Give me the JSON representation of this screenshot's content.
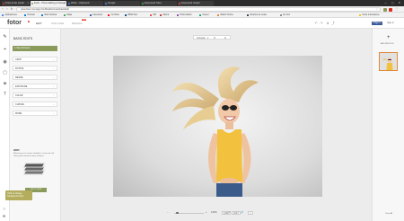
{
  "browser": {
    "tabs": [
      {
        "label": "8 test invite Gmail",
        "color": "#d93025"
      },
      {
        "label": "Fotor - Photo Editing & Design",
        "color": "#8a9a5b",
        "active": true
      },
      {
        "label": "Writer - Clipboard",
        "color": "#3b82f6"
      },
      {
        "label": "Google",
        "color": "#4285f4"
      },
      {
        "label": "Expressed Sites",
        "color": "#34a853"
      },
      {
        "label": "Expressed Insight",
        "color": "#ea4335"
      }
    ],
    "window_controls": "— ▢ ✕",
    "url": "www.fotor.com/app.html#/editor/main/basicEdit",
    "bookmarks": [
      {
        "label": "Aplicaciones",
        "color": "#4285f4"
      },
      {
        "label": "Hotmail",
        "color": "#0078d4"
      },
      {
        "label": "Web Outlook",
        "color": "#0078d4"
      },
      {
        "label": "Maps",
        "color": "#34a853"
      },
      {
        "label": "Facebook",
        "color": "#3b5998"
      },
      {
        "label": "YouTube",
        "color": "#ff0000"
      },
      {
        "label": "BBVA Net",
        "color": "#004481"
      },
      {
        "label": "WK",
        "color": "#e74c3c"
      },
      {
        "label": "Marca",
        "color": "#c0392b"
      },
      {
        "label": "Photo Editor",
        "color": "#8e44ad"
      },
      {
        "label": "Career",
        "color": "#16a085"
      },
      {
        "label": "Watch Online",
        "color": "#e67e22"
      },
      {
        "label": "Diseños de redes",
        "color": "#2c3e50"
      },
      {
        "label": "En Voz",
        "color": "#7f8c8d"
      },
      {
        "label": "Otros marcadores",
        "color": "#f1c40f"
      }
    ]
  },
  "app": {
    "logo": "fotor",
    "logo_badge": "®",
    "nav": [
      {
        "label": "EDIT",
        "active": true
      },
      {
        "label": "COLLAGE",
        "active": false
      },
      {
        "label": "DESIGN",
        "active": false
      }
    ],
    "new_badge": "NEW",
    "signin": "f Sign in",
    "signin2": "Sign in"
  },
  "left_rail": {
    "icons": [
      "wand-icon",
      "crop-icon",
      "eye-icon",
      "frame-icon",
      "sticker-icon",
      "text-icon"
    ]
  },
  "panel": {
    "title": "BASIC EDITS",
    "one_click": "1-Tap Enhance",
    "accordions": [
      "CROP",
      "ROTATE",
      "RESIZE",
      "EXPOSURE",
      "COLOR",
      "CURVES",
      "MORE"
    ],
    "hdr": {
      "title": "HDR",
      "desc": "Allowing you to capture highlights, enhanced and shifting with details of deep shadows.",
      "button": "TRY IT NOW"
    },
    "tooltip": "Click to change background color"
  },
  "canvas": {
    "toolbar": {
      "compare": "Compare",
      "compare_icon": "▾"
    },
    "zoom": {
      "minus": "−",
      "plus": "+",
      "percent": "100%",
      "size_w": "1200",
      "size_x": "x",
      "size_h": "1027",
      "fit": "⛶"
    }
  },
  "right_panel": {
    "add_label": "ADD PHOTOS",
    "clear_all": "Clear All"
  }
}
